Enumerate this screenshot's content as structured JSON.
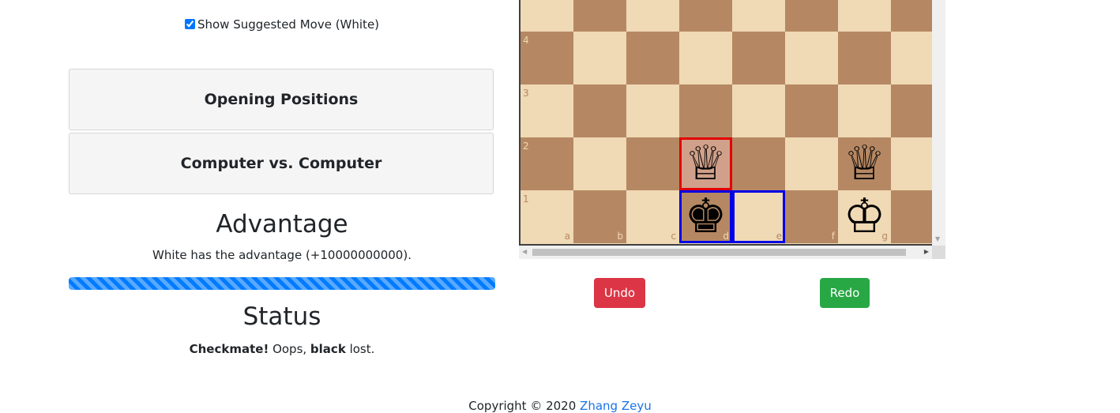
{
  "options": {
    "suggested_move_label": "Show Suggested Move (White)",
    "suggested_move_checked": true
  },
  "panels": {
    "opening_positions": "Opening Positions",
    "computer_vs_computer": "Computer vs. Computer"
  },
  "advantage": {
    "title": "Advantage",
    "text": "White has the advantage (+10000000000).",
    "bar_fill_percent": 100,
    "bar_color": "#007bff"
  },
  "status": {
    "title": "Status",
    "checkmate": "Checkmate!",
    "oops": " Oops, ",
    "loser": "black",
    "lost": " lost."
  },
  "board": {
    "light_color": "#f0d9b5",
    "dark_color": "#b58863",
    "visible_ranks": [
      "4",
      "3",
      "2",
      "1"
    ],
    "visible_files": [
      "a",
      "b",
      "c",
      "d",
      "e",
      "f",
      "g"
    ],
    "pieces": [
      {
        "square": "d2",
        "piece": "white-queen",
        "glyph": "♕"
      },
      {
        "square": "g2",
        "piece": "white-queen",
        "glyph": "♕"
      },
      {
        "square": "d1",
        "piece": "black-king",
        "glyph": "♚"
      },
      {
        "square": "g1",
        "piece": "white-king",
        "glyph": "♔"
      }
    ],
    "highlight_red": "d2",
    "highlight_blue": [
      "d1",
      "e1"
    ],
    "highlight_red_color": "#e30000",
    "highlight_blue_color": "#0000e6"
  },
  "buttons": {
    "undo": "Undo",
    "redo": "Redo",
    "undo_color": "#dc3545",
    "redo_color": "#28a745"
  },
  "footer": {
    "copyright": "Copyright © 2020 ",
    "author": "Zhang Zeyu"
  }
}
